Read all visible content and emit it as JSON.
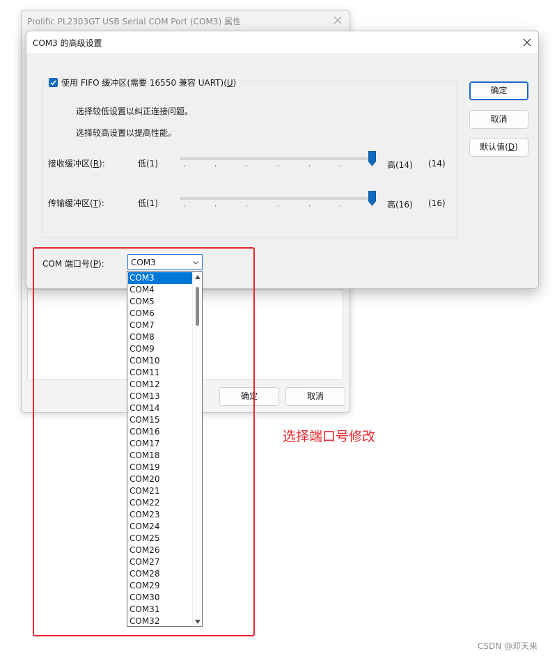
{
  "background_window": {
    "title": "Prolific PL2303GT USB Serial COM Port (COM3) 属性",
    "ok_label": "确定",
    "cancel_label": "取消"
  },
  "dialog": {
    "title": "COM3 的高级设置",
    "fifo": {
      "label": "使用 FIFO 缓冲区(需要 16550 兼容 UART)",
      "accelerator": "U",
      "checked": true
    },
    "hint_low": "选择较低设置以纠正连接问题。",
    "hint_high": "选择较高设置以提高性能。",
    "receive": {
      "label": "接收缓冲区",
      "accelerator": "R",
      "low": "低(1)",
      "high": "高(14)",
      "value_text": "(14)",
      "min": 1,
      "max": 14,
      "value": 14
    },
    "transmit": {
      "label": "传输缓冲区",
      "accelerator": "T",
      "low": "低(1)",
      "high": "高(16)",
      "value_text": "(16)",
      "min": 1,
      "max": 16,
      "value": 16
    },
    "buttons": {
      "ok": "确定",
      "cancel": "取消",
      "default": "默认值",
      "default_accelerator": "D"
    },
    "com_port": {
      "label": "COM 端口号",
      "accelerator": "P",
      "selected": "COM3",
      "options": [
        "COM3",
        "COM4",
        "COM5",
        "COM6",
        "COM7",
        "COM8",
        "COM9",
        "COM10",
        "COM11",
        "COM12",
        "COM13",
        "COM14",
        "COM15",
        "COM16",
        "COM17",
        "COM18",
        "COM19",
        "COM20",
        "COM21",
        "COM22",
        "COM23",
        "COM24",
        "COM25",
        "COM26",
        "COM27",
        "COM28",
        "COM29",
        "COM30",
        "COM31",
        "COM32"
      ]
    }
  },
  "annotation": {
    "text": "选择端口号修改",
    "color": "#e8262b"
  },
  "watermark": "CSDN @邓天来",
  "colors": {
    "accent": "#0078d7",
    "highlight_border": "#e8262b"
  },
  "icons": {
    "close": "close-icon",
    "checkmark": "checkmark-icon",
    "chevron": "chevron-down-icon",
    "scroll_up": "scroll-up-icon",
    "scroll_down": "scroll-down-icon"
  }
}
